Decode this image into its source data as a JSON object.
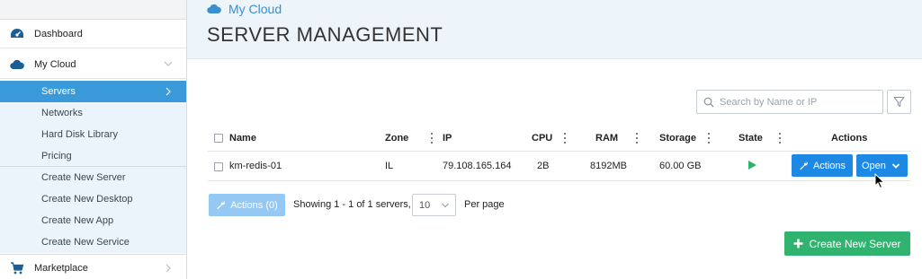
{
  "sidebar": {
    "items": [
      {
        "label": "Dashboard",
        "icon": "dashboard-gauge-icon"
      },
      {
        "label": "My Cloud",
        "icon": "cloud-icon"
      },
      {
        "label": "Marketplace",
        "icon": "shopping-cart-icon"
      }
    ],
    "sub_items": [
      {
        "label": "Servers",
        "active": true
      },
      {
        "label": "Networks"
      },
      {
        "label": "Hard Disk Library"
      },
      {
        "label": "Pricing"
      },
      {
        "label": "Create New Server"
      },
      {
        "label": "Create New Desktop"
      },
      {
        "label": "Create New App"
      },
      {
        "label": "Create New Service"
      }
    ]
  },
  "header": {
    "breadcrumb": "My Cloud",
    "breadcrumb_icon": "cloud-icon",
    "title": "SERVER MANAGEMENT"
  },
  "search": {
    "placeholder": "Search by Name or IP",
    "value": ""
  },
  "table": {
    "columns": [
      "Name",
      "Zone",
      "IP",
      "CPU",
      "RAM",
      "Storage",
      "State",
      "Actions"
    ],
    "rows": [
      {
        "name": "km-redis-01",
        "zone": "IL",
        "ip": "79.108.165.164",
        "cpu": "2B",
        "ram": "8192MB",
        "storage": "60.00 GB",
        "state": "running",
        "actions_label": "Actions",
        "open_label": "Open"
      }
    ]
  },
  "footer": {
    "bulk_actions_label": "Actions (0)",
    "showing_text": "Showing 1 - 1 of 1 servers,",
    "per_page_value": "10",
    "per_page_label": "Per page"
  },
  "create_button_label": "Create New Server",
  "colors": {
    "accent": "#1e88e5",
    "active_nav": "#3a9ad9",
    "success": "#2fb36e",
    "header_bg": "#edf4fa"
  }
}
